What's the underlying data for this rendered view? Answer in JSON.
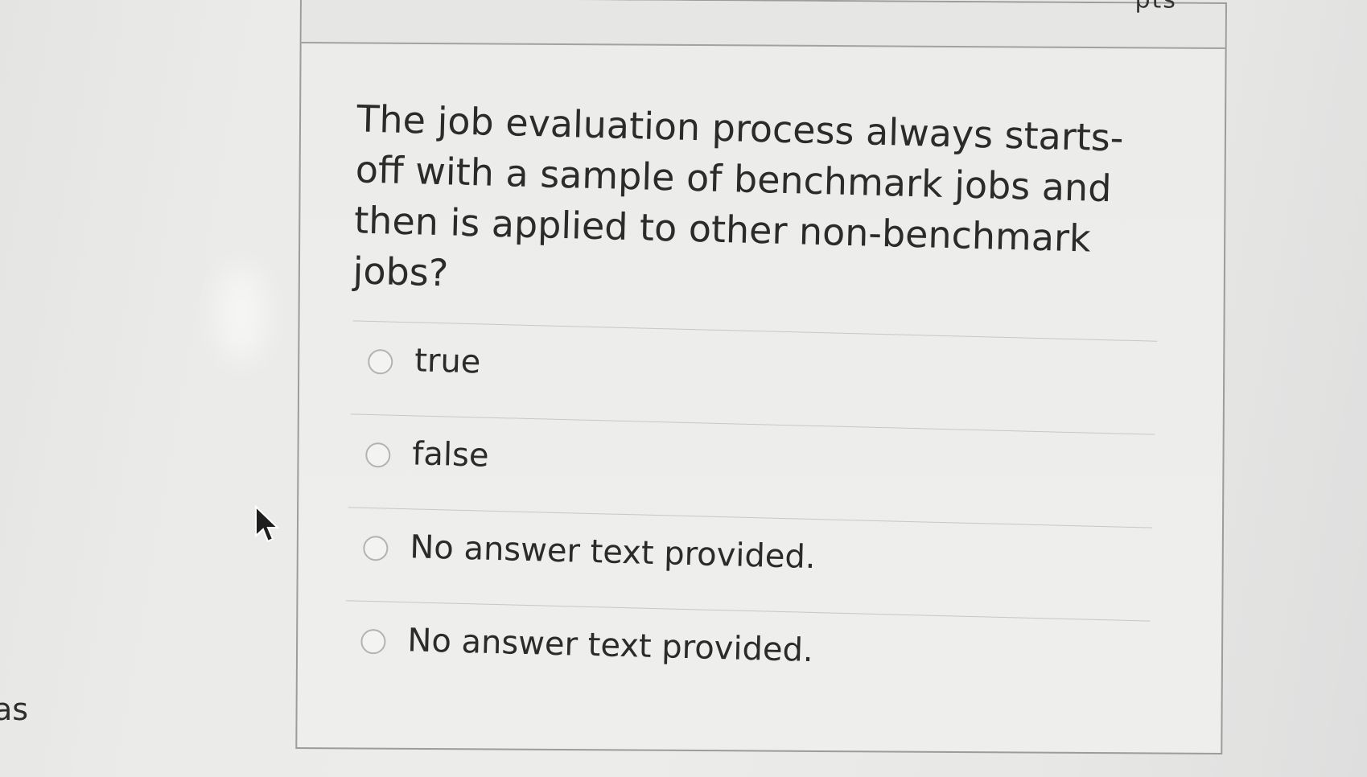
{
  "header": {
    "score_fragment": "pts"
  },
  "question": {
    "text": "The job evaluation process always starts-off with a sample of benchmark jobs and then is applied to other non-benchmark jobs?"
  },
  "answers": [
    {
      "label": "true",
      "selected": false
    },
    {
      "label": "false",
      "selected": false
    },
    {
      "label": "No answer text provided.",
      "selected": false
    },
    {
      "label": "No answer text provided.",
      "selected": false
    }
  ],
  "side_fragment": "as"
}
